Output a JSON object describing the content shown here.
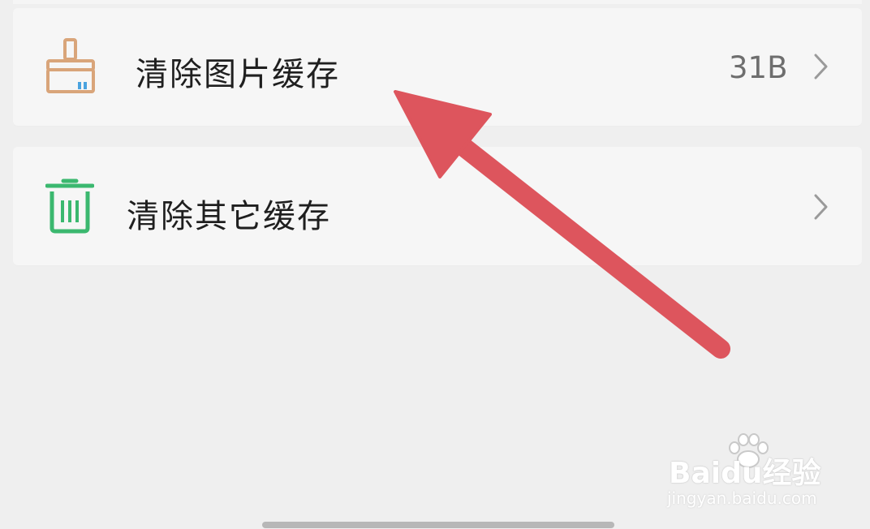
{
  "settings": {
    "items": [
      {
        "label": "清除图片缓存",
        "value": "31B",
        "icon": "broom-icon",
        "icon_color": "#d9a57a"
      },
      {
        "label": "清除其它缓存",
        "value": "",
        "icon": "trash-icon",
        "icon_color": "#3bb86f"
      }
    ]
  },
  "annotation": {
    "arrow_color": "#dd555d"
  },
  "watermark": {
    "brand": "Baidu经验",
    "site": "jingyan.baidu.com"
  }
}
